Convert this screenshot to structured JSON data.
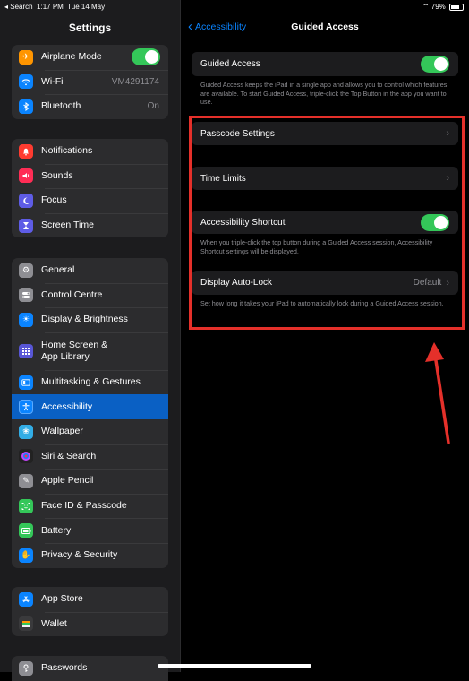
{
  "status_bar": {
    "back_app": "◂ Search",
    "time": "1:17 PM",
    "date": "Tue 14 May",
    "battery": "79%"
  },
  "sidebar": {
    "title": "Settings",
    "group1": [
      {
        "label": "Airplane Mode",
        "icon": "✈",
        "color": "#ff9500"
      },
      {
        "label": "Wi-Fi",
        "icon": "wifi",
        "color": "#0a84ff",
        "value": "VM4291174"
      },
      {
        "label": "Bluetooth",
        "icon": "bluetooth",
        "color": "#0a84ff",
        "value": "On"
      }
    ],
    "group2": [
      {
        "label": "Notifications",
        "icon": "bell",
        "color": "#ff3b30"
      },
      {
        "label": "Sounds",
        "icon": "speaker",
        "color": "#ff2d55"
      },
      {
        "label": "Focus",
        "icon": "moon",
        "color": "#5e5ce6"
      },
      {
        "label": "Screen Time",
        "icon": "hourglass",
        "color": "#5e5ce6"
      }
    ],
    "group3": [
      {
        "label": "General",
        "icon": "gear",
        "color": "#8e8e93"
      },
      {
        "label": "Control Centre",
        "icon": "switches",
        "color": "#8e8e93"
      },
      {
        "label": "Display & Brightness",
        "icon": "sun",
        "color": "#0a84ff"
      },
      {
        "label": "Home Screen &",
        "label2": "App Library",
        "icon": "grid",
        "color": "#5856d6"
      },
      {
        "label": "Multitasking & Gestures",
        "icon": "multitask",
        "color": "#0a84ff"
      },
      {
        "label": "Accessibility",
        "icon": "accessibility",
        "color": "#0a84ff"
      },
      {
        "label": "Wallpaper",
        "icon": "flower",
        "color": "#32ade6"
      },
      {
        "label": "Siri & Search",
        "icon": "siri",
        "color": "#222"
      },
      {
        "label": "Apple Pencil",
        "icon": "pencil",
        "color": "#8e8e93"
      },
      {
        "label": "Face ID & Passcode",
        "icon": "faceid",
        "color": "#34c759"
      },
      {
        "label": "Battery",
        "icon": "battery",
        "color": "#34c759"
      },
      {
        "label": "Privacy & Security",
        "icon": "hand",
        "color": "#0a84ff"
      }
    ],
    "group4": [
      {
        "label": "App Store",
        "icon": "appstore",
        "color": "#0a84ff"
      },
      {
        "label": "Wallet",
        "icon": "wallet",
        "color": "#3a3a3c"
      }
    ],
    "group5": [
      {
        "label": "Passwords",
        "icon": "key",
        "color": "#8e8e93"
      }
    ]
  },
  "detail": {
    "back_label": "Accessibility",
    "title": "Guided Access",
    "guided_access_label": "Guided Access",
    "guided_access_footer": "Guided Access keeps the iPad in a single app and allows you to control which features are available. To start Guided Access, triple-click the Top Button in the app you want to use.",
    "passcode_label": "Passcode Settings",
    "time_limits_label": "Time Limits",
    "shortcut_label": "Accessibility Shortcut",
    "shortcut_footer": "When you triple-click the top button during a Guided Access session, Accessibility Shortcut settings will be displayed.",
    "autolock_label": "Display Auto-Lock",
    "autolock_value": "Default",
    "autolock_footer": "Set how long it takes your iPad to automatically lock during a Guided Access session."
  },
  "colors": {
    "accent": "#0a84ff",
    "toggle_on": "#34c759",
    "highlight": "#e5302a"
  }
}
